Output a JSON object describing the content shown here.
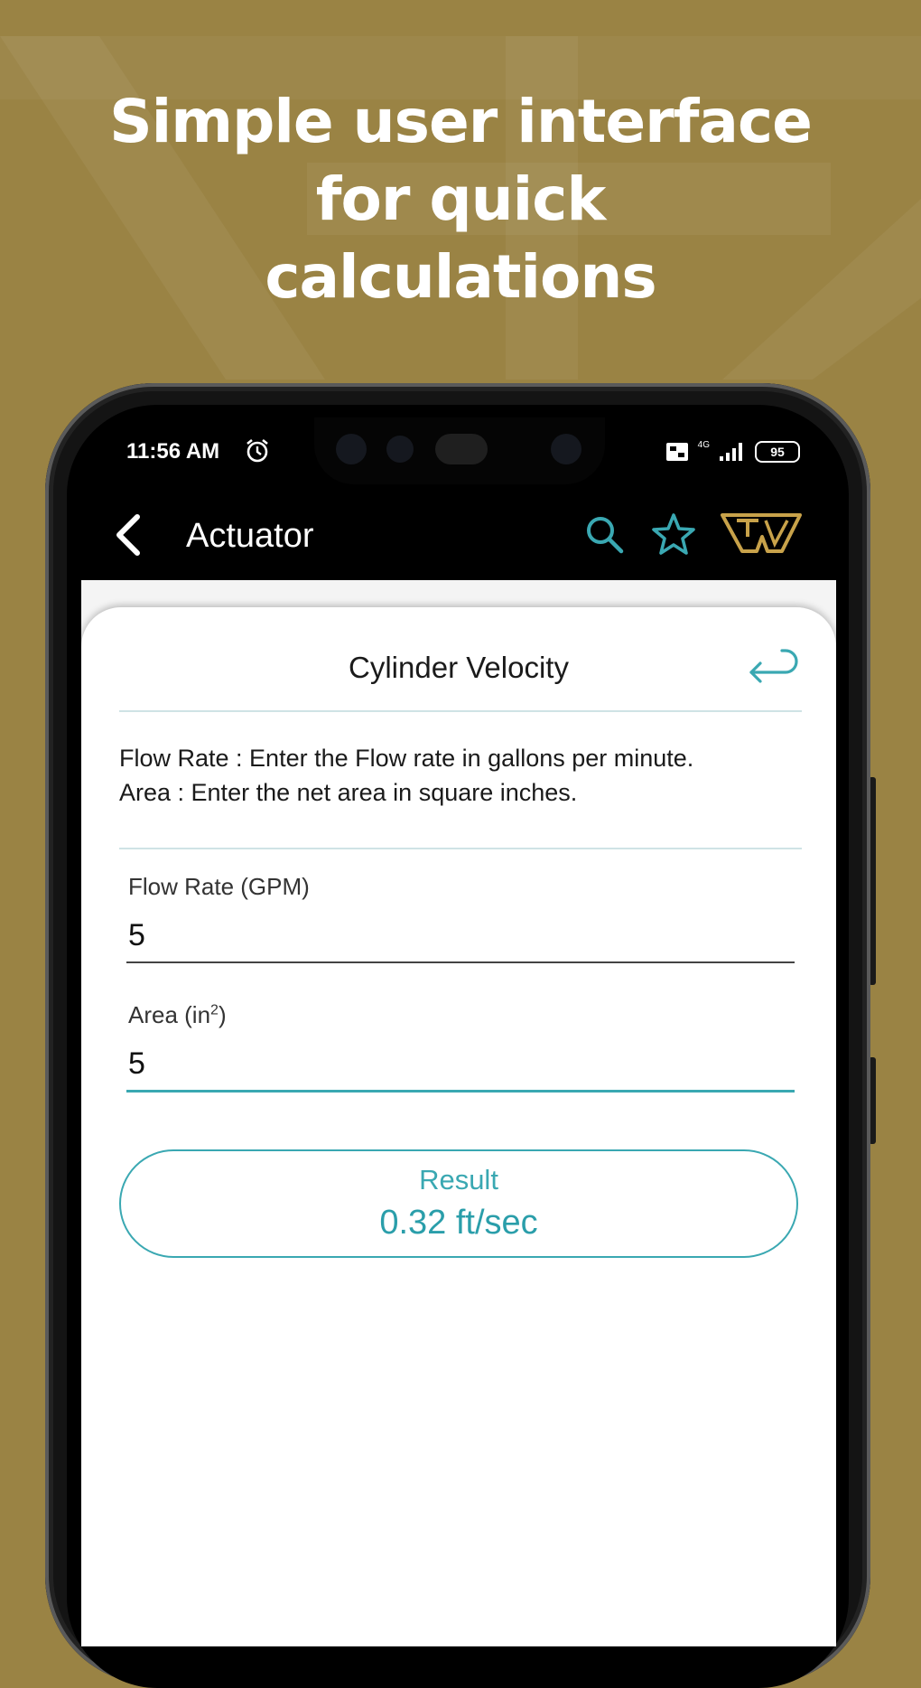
{
  "headline": {
    "line1": "Simple user interface",
    "line2": "for quick",
    "line3": "calculations"
  },
  "status_bar": {
    "time": "11:56 AM",
    "network": "4G",
    "battery": "95",
    "icons": [
      "alarm-icon",
      "screen-record-icon",
      "signal-icon",
      "battery-icon"
    ]
  },
  "app_bar": {
    "title": "Actuator",
    "icons": [
      "back-arrow-icon",
      "search-icon",
      "star-icon",
      "brand-logo-icon"
    ]
  },
  "calculator": {
    "title": "Cylinder Velocity",
    "help_line1": "Flow Rate : Enter the Flow rate in gallons per minute.",
    "help_line2": "Area : Enter the net area in square inches.",
    "flow_label": "Flow Rate (GPM)",
    "flow_value": "5",
    "area_label": "Area (in",
    "area_sup": "2",
    "area_close": ")",
    "area_value": "5",
    "result_label": "Result",
    "result_value": "0.32 ft/sec"
  },
  "colors": {
    "background": "#9a8344",
    "accent": "#3aa8b2",
    "logo": "#c8a24a"
  }
}
